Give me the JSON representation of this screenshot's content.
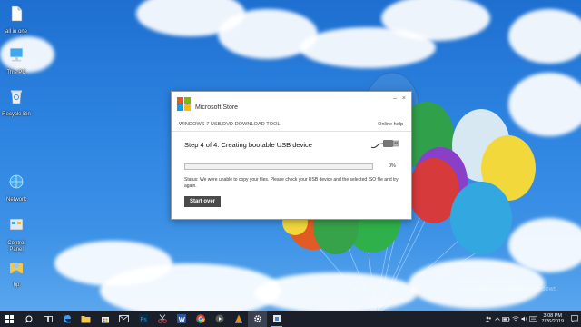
{
  "desktop": {
    "icons": [
      {
        "label": "all in one",
        "icon": "file-icon"
      },
      {
        "label": "This PC",
        "icon": "computer-icon"
      },
      {
        "label": "Recycle Bin",
        "icon": "recycle-bin-icon"
      },
      {
        "label": "Network",
        "icon": "network-icon"
      },
      {
        "label": "Control Panel",
        "icon": "control-panel-icon"
      },
      {
        "label": "hp",
        "icon": "user-folder-icon"
      }
    ],
    "watermark": {
      "line1": "Activate Windows",
      "line2": "Go to Settings to activate Windows."
    }
  },
  "dialog": {
    "brand": "Microsoft Store",
    "tool_title": "WINDOWS 7 USB/DVD DOWNLOAD TOOL",
    "help_link": "Online help",
    "step_title": "Step 4 of 4: Creating bootable USB device",
    "progress_percent_label": "0%",
    "progress_value": 0,
    "status": "Status:  We were unable to copy your files.  Please check your USB device and the selected ISO file and try again.",
    "start_over": "Start over",
    "minimize": "–",
    "close": "×"
  },
  "taskbar": {
    "time": "3:08 PM",
    "date": "7/26/2019",
    "apps": [
      "start",
      "search",
      "task-view",
      "edge",
      "file-explorer",
      "store",
      "mail",
      "photoshop",
      "snipping-tool",
      "word",
      "chrome",
      "media-player",
      "vlc",
      "settings",
      "usb-tool"
    ]
  },
  "colors": {
    "progress": "#06b025",
    "button": "#4a4a4a",
    "taskbar": "#1a1f2a"
  }
}
